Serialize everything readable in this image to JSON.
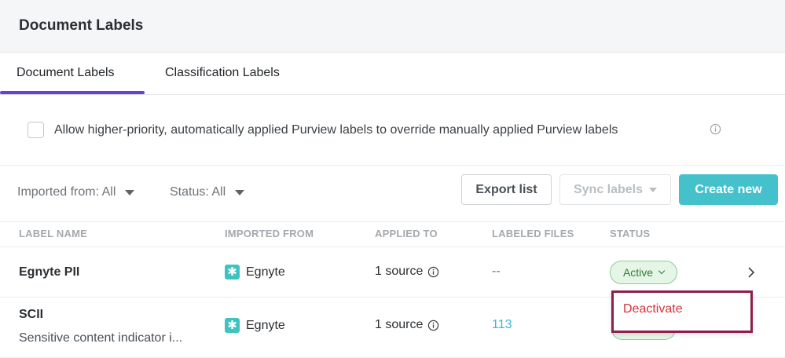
{
  "header": {
    "title": "Document Labels"
  },
  "tabs": [
    {
      "label": "Document Labels",
      "active": true
    },
    {
      "label": "Classification Labels",
      "active": false
    }
  ],
  "setting": {
    "checked": false,
    "text": "Allow higher-priority, automatically applied Purview labels to override manually applied Purview labels"
  },
  "filters": {
    "imported_from": "Imported from: All",
    "status": "Status: All"
  },
  "toolbar": {
    "export_label": "Export list",
    "sync_label": "Sync labels",
    "create_label": "Create new"
  },
  "table": {
    "columns": [
      "LABEL NAME",
      "IMPORTED FROM",
      "APPLIED TO",
      "LABELED FILES",
      "STATUS"
    ],
    "rows": [
      {
        "name": "Egnyte PII",
        "description": "",
        "imported_from": "Egnyte",
        "applied_to": "1 source",
        "labeled_files": "--",
        "status": "Active"
      },
      {
        "name": "SCII",
        "description": "Sensitive content indicator i...",
        "imported_from": "Egnyte",
        "applied_to": "1 source",
        "labeled_files": "113",
        "status": ""
      }
    ]
  },
  "status_menu": {
    "items": [
      "Deactivate"
    ]
  },
  "colors": {
    "accent": "#6a3fd3",
    "primary_button": "#45c1cc",
    "active_status": "#2e7d37",
    "danger": "#d2323c",
    "highlight_border": "#8c1f4c"
  }
}
